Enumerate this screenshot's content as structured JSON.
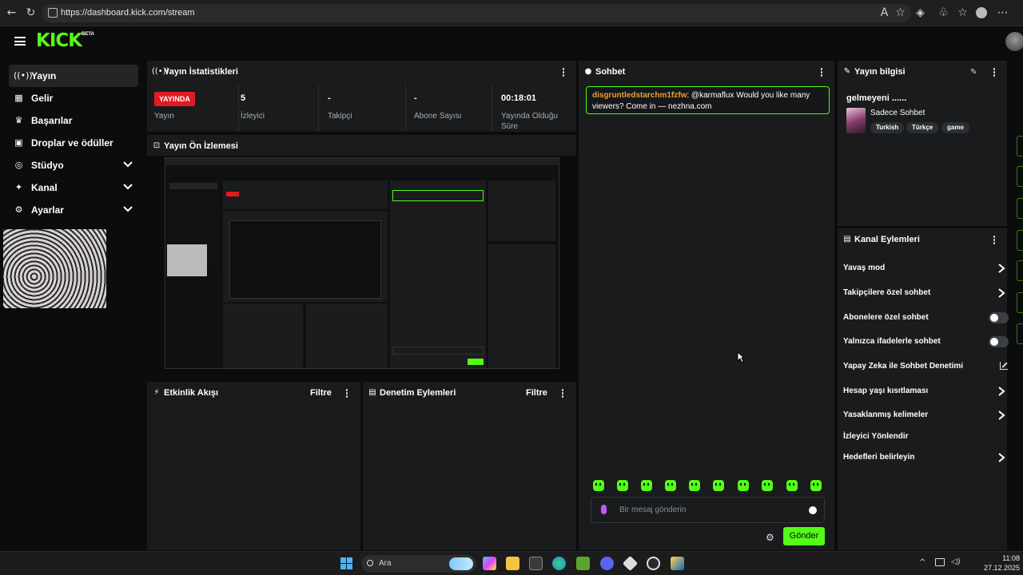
{
  "browser": {
    "url": "https://dashboard.kick.com/stream"
  },
  "header": {
    "logo": "KICK",
    "beta": "BETA"
  },
  "sidebar": {
    "items": [
      {
        "label": "Yayın",
        "icon": "broadcast-icon"
      },
      {
        "label": "Gelir",
        "icon": "revenue-icon"
      },
      {
        "label": "Başarılar",
        "icon": "trophy-icon"
      },
      {
        "label": "Droplar ve ödüller",
        "icon": "gift-icon"
      },
      {
        "label": "Stüdyo",
        "icon": "studio-icon"
      },
      {
        "label": "Kanal",
        "icon": "channel-icon"
      },
      {
        "label": "Ayarlar",
        "icon": "settings-icon"
      }
    ]
  },
  "stats": {
    "title": "Yayın İstatistikleri",
    "live_badge": "YAYINDA",
    "columns": [
      {
        "value": "",
        "label": "Yayın"
      },
      {
        "value": "5",
        "label": "İzleyici"
      },
      {
        "value": "-",
        "label": "Takipçi"
      },
      {
        "value": "-",
        "label": "Abone Sayısı"
      },
      {
        "value": "00:18:01",
        "label": "Yayında Olduğu Süre"
      }
    ]
  },
  "preview": {
    "title": "Yayın Ön İzlemesi"
  },
  "activity": {
    "title": "Etkinlik Akışı",
    "filter": "Filtre"
  },
  "moderation": {
    "title": "Denetim Eylemleri",
    "filter": "Filtre"
  },
  "chat": {
    "title": "Sohbet",
    "message_user": "disgruntledstarchm1fzfw",
    "message_text": ": @karmaflux Would you like many viewers? Come in — nezhna.com",
    "placeholder": "Bir mesaj gönderin",
    "send": "Gönder"
  },
  "stream_info": {
    "title": "Yayın bilgisi",
    "stream_title": "gelmeyeni ......",
    "category": "Sadece Sohbet",
    "tags": [
      "Turkish",
      "Türkçe",
      "game"
    ]
  },
  "channel_actions": {
    "title": "Kanal Eylemleri",
    "items": [
      {
        "label": "Yavaş mod",
        "control": "chevron"
      },
      {
        "label": "Takipçilere özel sohbet",
        "control": "chevron"
      },
      {
        "label": "Abonelere özel sohbet",
        "control": "toggle",
        "on": false
      },
      {
        "label": "Yalnızca ifadelerle sohbet",
        "control": "toggle",
        "on": false
      },
      {
        "label": "Yapay Zeka ile Sohbet Denetimi",
        "control": "external"
      },
      {
        "label": "Hesap yaşı kısıtlaması",
        "control": "chevron"
      },
      {
        "label": "Yasaklanmış kelimeler",
        "control": "chevron"
      },
      {
        "label": "İzleyici Yönlendir",
        "control": "none"
      },
      {
        "label": "Hedefleri belirleyin",
        "control": "chevron"
      }
    ]
  },
  "taskbar": {
    "search": "Ara",
    "time": "11:08",
    "date": "27.12.2025"
  },
  "colors": {
    "accent": "#53fc18",
    "live": "#e21a26",
    "panel": "#191b1c",
    "background": "#0b0c0d"
  }
}
